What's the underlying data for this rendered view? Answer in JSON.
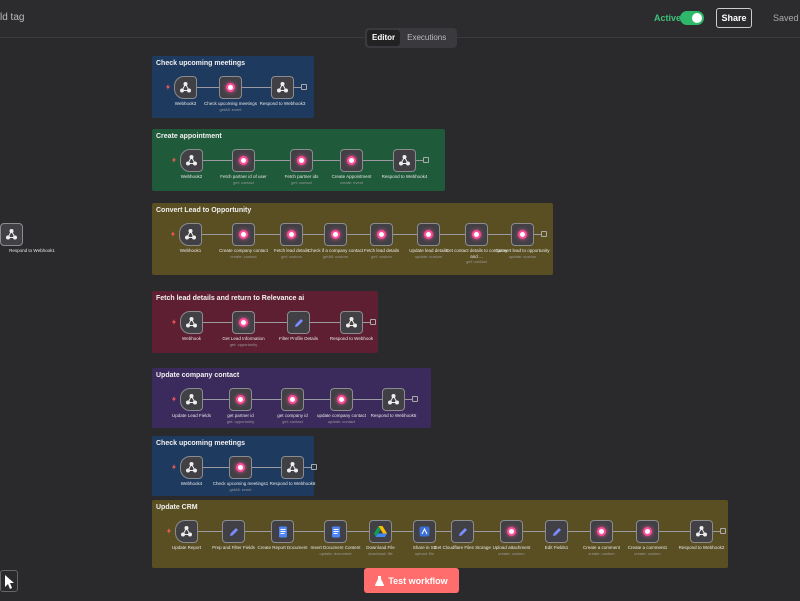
{
  "header": {
    "add_tag": "ld tag",
    "active_label": "Active",
    "share_label": "Share",
    "saved_label": "Saved"
  },
  "tabs": [
    {
      "label": "Editor",
      "active": true
    },
    {
      "label": "Executions",
      "active": false
    }
  ],
  "test_button_label": "Test workflow",
  "colors": {
    "blue": "#1f3a5f",
    "green": "#1f5a3a",
    "olive": "#5a4f22",
    "red": "#5f1f33",
    "purple": "#3b2a5c",
    "accent": "#ff6d6d"
  },
  "groups": [
    {
      "title": "Check upcoming meetings",
      "color": "blue",
      "nodes": [
        {
          "label": "Webhook3",
          "sub": "",
          "kind": "webhook"
        },
        {
          "label": "Check upcoming meetings",
          "sub": "getAll: event",
          "kind": "dot"
        },
        {
          "label": "Respond to Webhook3",
          "sub": "",
          "kind": "webhook"
        }
      ]
    },
    {
      "title": "Create appointment",
      "color": "green",
      "nodes": [
        {
          "label": "Webhook2",
          "sub": "",
          "kind": "webhook"
        },
        {
          "label": "Fetch partner id of user",
          "sub": "get: contact",
          "kind": "dot"
        },
        {
          "label": "Fetch partner ids",
          "sub": "get: contact",
          "kind": "dot"
        },
        {
          "label": "Create Appointment",
          "sub": "create: event",
          "kind": "dot"
        },
        {
          "label": "Respond to Webhook4",
          "sub": "",
          "kind": "webhook"
        }
      ]
    },
    {
      "title": "Convert Lead to Opportunity",
      "color": "olive",
      "nodes": [
        {
          "label": "Webhook1",
          "sub": "",
          "kind": "webhook"
        },
        {
          "label": "Create company contact",
          "sub": "create: contact",
          "kind": "dot"
        },
        {
          "label": "Fetch lead details",
          "sub": "get: custom",
          "kind": "dot"
        },
        {
          "label": "Check if a company contact",
          "sub": "getAll: custom",
          "kind": "dot"
        },
        {
          "label": "Fetch lead details",
          "sub": "get: custom",
          "kind": "dot"
        },
        {
          "label": "Update lead details",
          "sub": "update: custom",
          "kind": "dot"
        },
        {
          "label": "Get contact details to company and ...",
          "sub": "get: contact",
          "kind": "dot"
        },
        {
          "label": "Convert lead to opportunity",
          "sub": "update: custom",
          "kind": "dot"
        },
        {
          "label": "Respond to Webhook1",
          "sub": "",
          "kind": "webhook"
        }
      ]
    },
    {
      "title": "Fetch lead details and return to Relevance ai",
      "color": "red",
      "nodes": [
        {
          "label": "Webhook",
          "sub": "",
          "kind": "webhook"
        },
        {
          "label": "Get Lead Information",
          "sub": "get: opportunity",
          "kind": "dot"
        },
        {
          "label": "Filter Profile Details",
          "sub": "",
          "kind": "pencil"
        },
        {
          "label": "Respond to Webhook",
          "sub": "",
          "kind": "webhook"
        }
      ]
    },
    {
      "title": "Update company contact",
      "color": "purple",
      "nodes": [
        {
          "label": "Update Lead Fields",
          "sub": "",
          "kind": "webhook"
        },
        {
          "label": "get partner id",
          "sub": "get: opportunity",
          "kind": "dot"
        },
        {
          "label": "get company id",
          "sub": "get: contact",
          "kind": "dot"
        },
        {
          "label": "update company contact",
          "sub": "update: contact",
          "kind": "dot"
        },
        {
          "label": "Respond to Webhook5",
          "sub": "",
          "kind": "webhook"
        }
      ]
    },
    {
      "title": "Check upcoming meetings",
      "color": "blue",
      "nodes": [
        {
          "label": "Webhook4",
          "sub": "",
          "kind": "webhook"
        },
        {
          "label": "Check upcoming meetings1",
          "sub": "getAll: event",
          "kind": "dot"
        },
        {
          "label": "Respond to Webhook6",
          "sub": "",
          "kind": "webhook"
        }
      ]
    },
    {
      "title": "Update CRM",
      "color": "olive",
      "nodes": [
        {
          "label": "Update Report",
          "sub": "",
          "kind": "webhook"
        },
        {
          "label": "Prep and Filter Fields",
          "sub": "",
          "kind": "pencil"
        },
        {
          "label": "Create Report Document",
          "sub": "",
          "kind": "doc"
        },
        {
          "label": "Insert Document Content",
          "sub": "update: document",
          "kind": "doc"
        },
        {
          "label": "Download File",
          "sub": "download: file",
          "kind": "drive"
        },
        {
          "label": "Share in S3",
          "sub": "upload: file",
          "kind": "share"
        },
        {
          "label": "Get Cloudflare Files Storage",
          "sub": "",
          "kind": "pencil"
        },
        {
          "label": "Upload attachment",
          "sub": "create: custom",
          "kind": "dot"
        },
        {
          "label": "Edit Fields1",
          "sub": "",
          "kind": "pencil"
        },
        {
          "label": "Create a comment",
          "sub": "create: custom",
          "kind": "dot"
        },
        {
          "label": "Create a comment1",
          "sub": "create: custom",
          "kind": "dot"
        },
        {
          "label": "Respond to Webhook2",
          "sub": "",
          "kind": "webhook"
        }
      ]
    }
  ]
}
